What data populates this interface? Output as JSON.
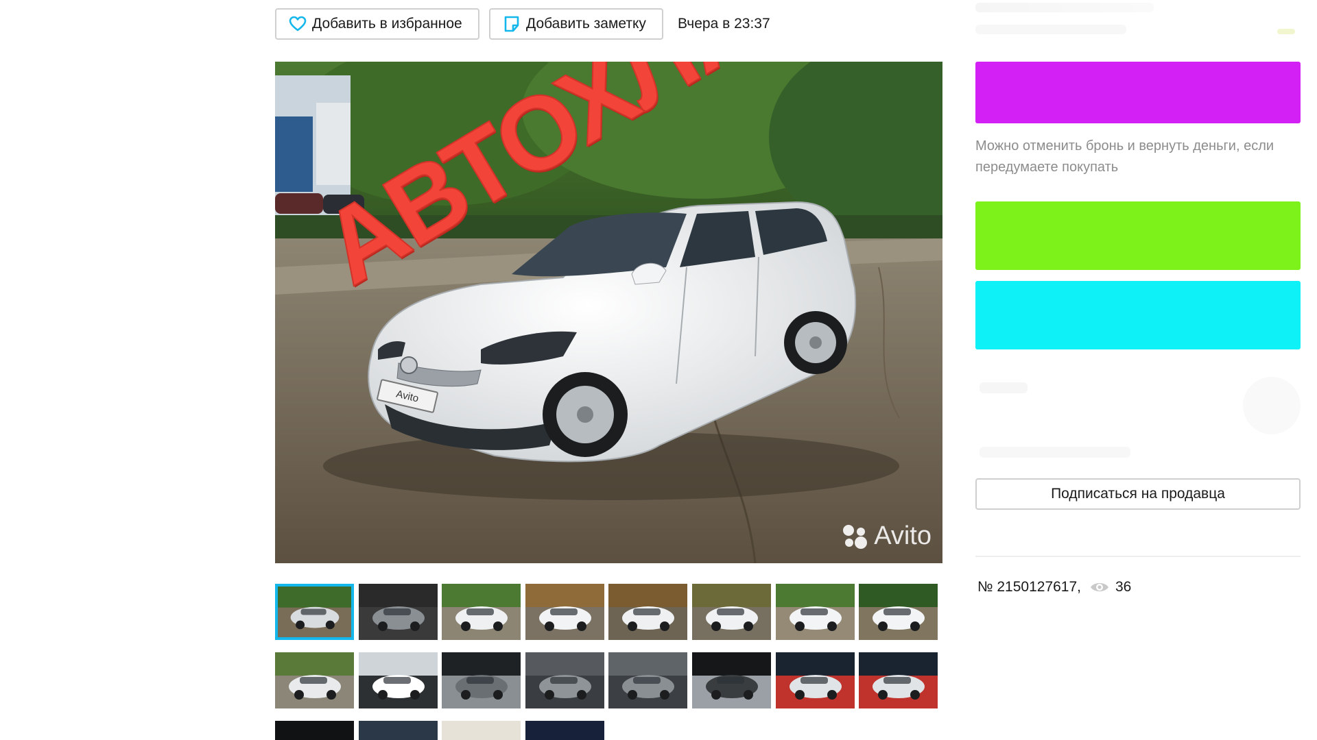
{
  "toolbar": {
    "favorite_label": "Добавить в избранное",
    "note_label": "Добавить заметку",
    "posted_time": "Вчера в 23:37"
  },
  "photo": {
    "overlay_caption": "АВТОХЛАМ",
    "watermark": "Avito",
    "plate_text": "Avito",
    "thumbnail_count": 20,
    "selected_thumbnail": 1
  },
  "sidebar": {
    "booking_note": "Можно отменить бронь и вернуть деньги, если передумаете покупать",
    "subscribe_label": "Подписаться на продавца",
    "redaction_colors": {
      "purple": "#d321f5",
      "green": "#7cf21a",
      "cyan": "#0ef1f6"
    }
  },
  "meta": {
    "listing_number": "№ 2150127617,",
    "views_count": "36"
  },
  "colors": {
    "overlay_red": "#f24438",
    "selected_thumb_border": "#14b7ec",
    "favorite_icon": "#14b7ec",
    "note_icon": "#14b7ec"
  },
  "icons": {
    "favorite": "heart-icon",
    "note": "note-icon",
    "views": "eye-icon",
    "watermark": "avito-dots-icon"
  }
}
